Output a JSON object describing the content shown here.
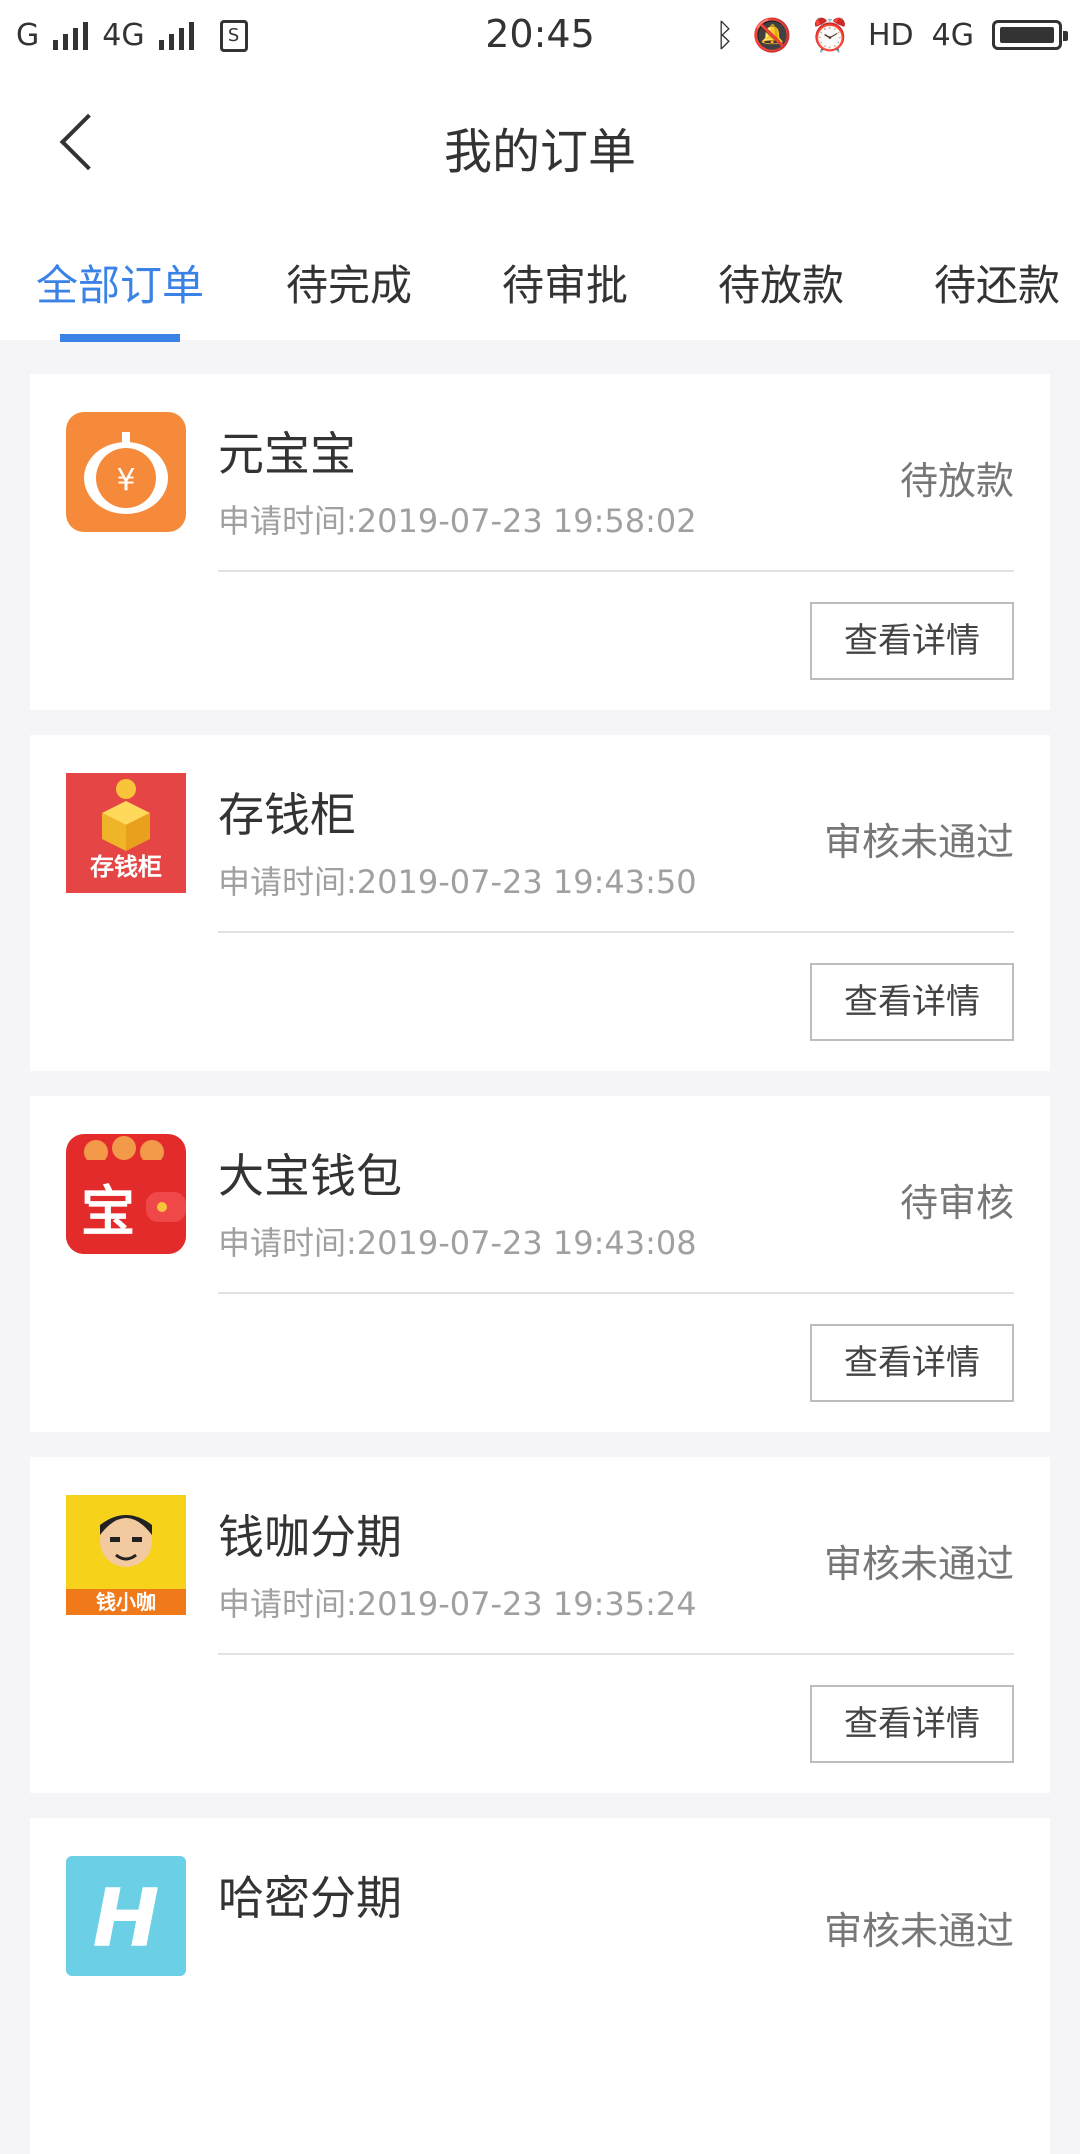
{
  "status_bar": {
    "carrier1": "G",
    "carrier2": "4G",
    "time": "20:45",
    "hd": "HD",
    "net": "4G"
  },
  "header": {
    "title": "我的订单"
  },
  "tabs": [
    {
      "label": "全部订单",
      "active": true
    },
    {
      "label": "待完成",
      "active": false
    },
    {
      "label": "待审批",
      "active": false
    },
    {
      "label": "待放款",
      "active": false
    },
    {
      "label": "待还款",
      "active": false
    }
  ],
  "colors": {
    "accent": "#3b82e6",
    "status_text": "#777777",
    "subtext": "#a0a0a0"
  },
  "orders": [
    {
      "name": "元宝宝",
      "apply_time": "申请时间:2019-07-23 19:58:02",
      "status": "待放款",
      "button": "查看详情",
      "logo_icon": "pumpkin-yuan-icon",
      "logo_text": "¥"
    },
    {
      "name": "存钱柜",
      "apply_time": "申请时间:2019-07-23 19:43:50",
      "status": "审核未通过",
      "button": "查看详情",
      "logo_icon": "gift-box-icon",
      "logo_text": "存钱柜"
    },
    {
      "name": "大宝钱包",
      "apply_time": "申请时间:2019-07-23 19:43:08",
      "status": "待审核",
      "button": "查看详情",
      "logo_icon": "wallet-icon",
      "logo_text": "宝"
    },
    {
      "name": "钱咖分期",
      "apply_time": "申请时间:2019-07-23 19:35:24",
      "status": "审核未通过",
      "button": "查看详情",
      "logo_icon": "cartoon-man-icon",
      "logo_text": "钱小咖"
    },
    {
      "name": "哈密分期",
      "apply_time": "",
      "status": "审核未通过",
      "button": "",
      "logo_icon": "letter-h-icon",
      "logo_text": "H"
    }
  ]
}
